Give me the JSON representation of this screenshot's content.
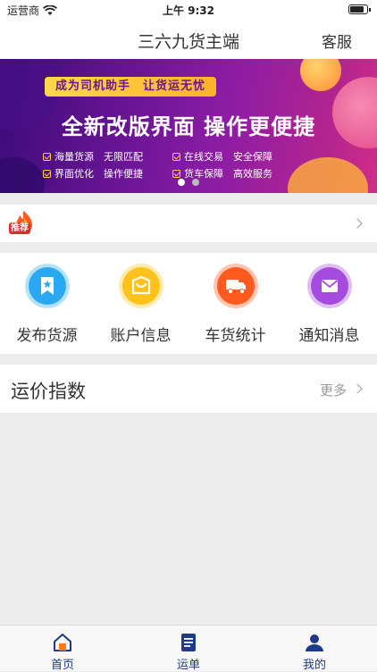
{
  "status_bar": {
    "carrier": "运营商",
    "time": "上午 9:32",
    "battery_level": 0.9
  },
  "nav": {
    "title": "三六九货主端",
    "right_action": "客服"
  },
  "banner": {
    "tagline": "成为司机助手　让货运无忧",
    "headline": "全新改版界面 操作更便捷",
    "features": [
      "海量货源　无限匹配",
      "在线交易　安全保障",
      "界面优化　操作便捷",
      "货车保障　高效服务"
    ],
    "active_page": 1,
    "page_count": 2
  },
  "recommend": {
    "badge": "推荐"
  },
  "quick_actions": [
    {
      "label": "发布货源",
      "icon": "bookmark-star-icon",
      "color": "#2aa8f2"
    },
    {
      "label": "账户信息",
      "icon": "wallet-icon",
      "color": "#ffc21a"
    },
    {
      "label": "车货统计",
      "icon": "truck-icon",
      "color": "#ff5a1f"
    },
    {
      "label": "通知消息",
      "icon": "mail-icon",
      "color": "#a64bdf"
    }
  ],
  "rate_index": {
    "title": "运价指数",
    "more": "更多"
  },
  "tabs": [
    {
      "label": "首页",
      "icon": "home-icon"
    },
    {
      "label": "运单",
      "icon": "document-icon"
    },
    {
      "label": "我的",
      "icon": "user-icon"
    }
  ],
  "colors": {
    "tab_active": "#1e3a8a",
    "banner_accent": "#ffcc3a"
  }
}
